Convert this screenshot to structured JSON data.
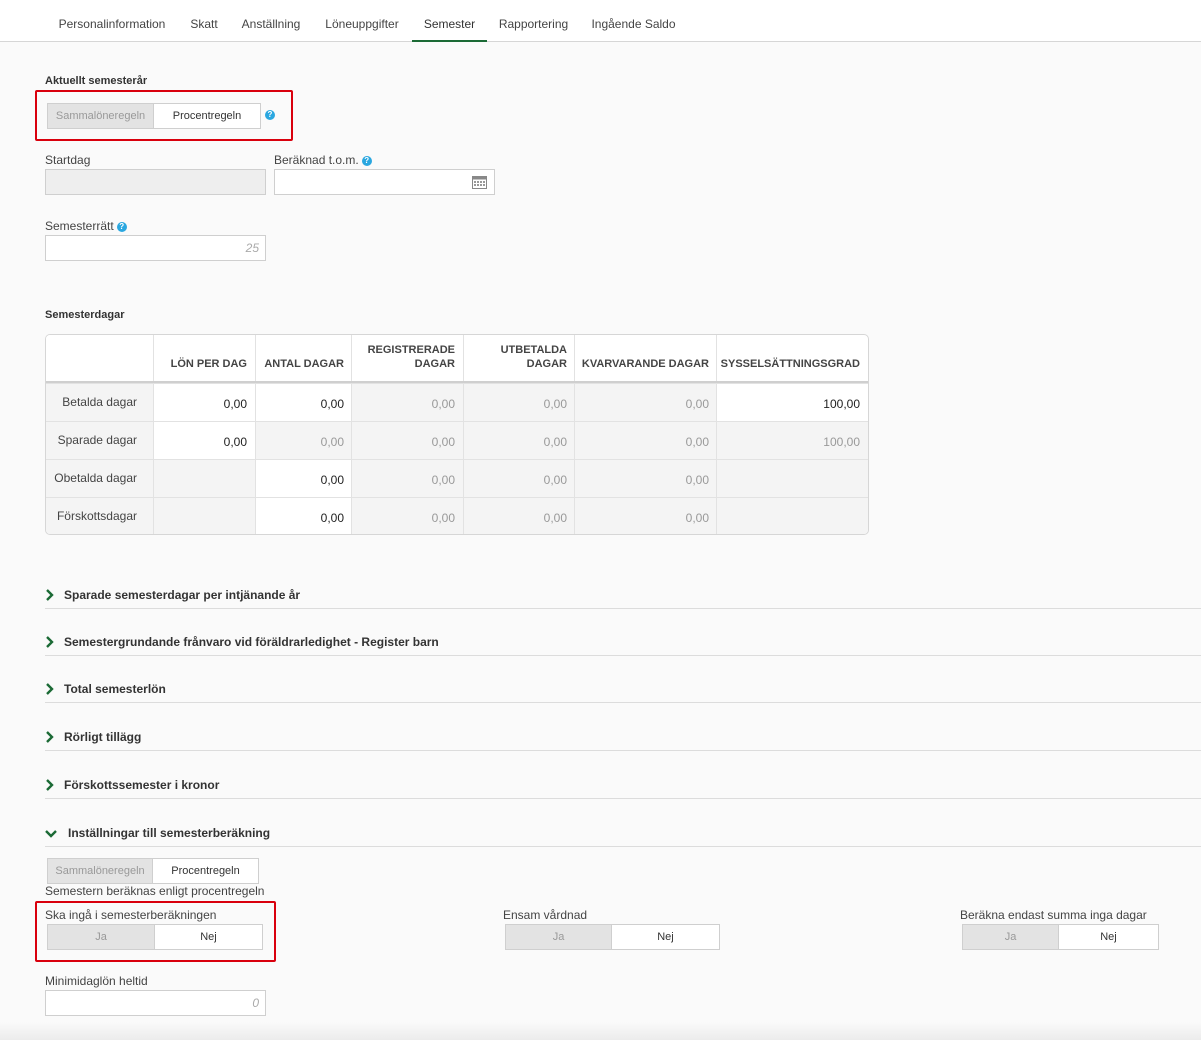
{
  "tabs": [
    {
      "label": "Personalinformation"
    },
    {
      "label": "Skatt"
    },
    {
      "label": "Anställning"
    },
    {
      "label": "Löneuppgifter"
    },
    {
      "label": "Semester",
      "active": true
    },
    {
      "label": "Rapportering"
    },
    {
      "label": "Ingående Saldo"
    }
  ],
  "current_year": {
    "title": "Aktuellt semesterår",
    "toggle": {
      "option1": "Sammalöneregeln",
      "option2": "Procentregeln",
      "selected": "Procentregeln"
    },
    "startdag_label": "Startdag",
    "startdag_value": "",
    "beraknad_label": "Beräknad t.o.m.",
    "beraknad_value": "",
    "semesterratt_label": "Semesterrätt",
    "semesterratt_placeholder": "25"
  },
  "semesterdagar": {
    "title": "Semesterdagar",
    "headers": {
      "lon": "LÖN PER DAG",
      "antal": "ANTAL DAGAR",
      "reg1": "REGISTRERADE",
      "reg2": "DAGAR",
      "utb1": "UTBETALDA",
      "utb2": "DAGAR",
      "kvar": "KVARVARANDE DAGAR",
      "syss": "SYSSELSÄTTNINGSGRAD"
    },
    "rows": [
      {
        "label": "Betalda dagar",
        "lon": "0,00",
        "antal": "0,00",
        "reg": "0,00",
        "utb": "0,00",
        "kvar": "0,00",
        "syss": "100,00"
      },
      {
        "label": "Sparade dagar",
        "lon": "0,00",
        "antal": "0,00",
        "reg": "0,00",
        "utb": "0,00",
        "kvar": "0,00",
        "syss": "100,00"
      },
      {
        "label": "Obetalda dagar",
        "lon": "",
        "antal": "0,00",
        "reg": "0,00",
        "utb": "0,00",
        "kvar": "0,00",
        "syss": ""
      },
      {
        "label": "Förskottsdagar",
        "lon": "",
        "antal": "0,00",
        "reg": "0,00",
        "utb": "0,00",
        "kvar": "0,00",
        "syss": ""
      }
    ]
  },
  "sections": [
    {
      "title": "Sparade semesterdagar per intjänande år",
      "expanded": false
    },
    {
      "title": "Semestergrundande frånvaro vid föräldrarledighet - Register barn",
      "expanded": false
    },
    {
      "title": "Total semesterlön",
      "expanded": false
    },
    {
      "title": "Rörligt tillägg",
      "expanded": false
    },
    {
      "title": "Förskottssemester i kronor",
      "expanded": false
    },
    {
      "title": "Inställningar till semesterberäkning",
      "expanded": true
    }
  ],
  "settings": {
    "rule_toggle": {
      "option1": "Sammalöneregeln",
      "option2": "Procentregeln",
      "selected": "Procentregeln"
    },
    "rule_note": "Semestern beräknas enligt procentregeln",
    "ska_inga_label": "Ska ingå i semesterberäkningen",
    "ska_inga": {
      "yes": "Ja",
      "no": "Nej",
      "selected": "Nej"
    },
    "ensam_label": "Ensam vårdnad",
    "ensam": {
      "yes": "Ja",
      "no": "Nej",
      "selected": "Nej"
    },
    "berakna_label": "Beräkna endast summa inga dagar",
    "berakna": {
      "yes": "Ja",
      "no": "Nej",
      "selected": "Nej"
    },
    "min_label": "Minimidaglön heltid",
    "min_placeholder": "0"
  },
  "colors": {
    "accent": "#1b6a35",
    "highlight": "#d9000d",
    "help": "#2aa7e0"
  }
}
